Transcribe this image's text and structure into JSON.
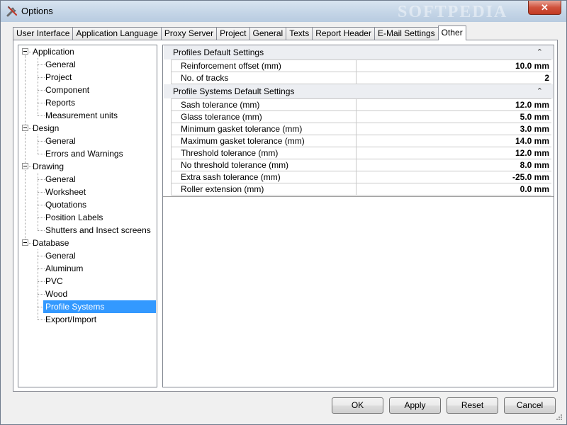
{
  "window": {
    "title": "Options",
    "close_glyph": "✕",
    "watermark": "SOFTPEDIA"
  },
  "tabs": [
    {
      "label": "User Interface",
      "active": false
    },
    {
      "label": "Application Language",
      "active": false
    },
    {
      "label": "Proxy Server",
      "active": false
    },
    {
      "label": "Project",
      "active": false
    },
    {
      "label": "General",
      "active": false
    },
    {
      "label": "Texts",
      "active": false
    },
    {
      "label": "Report Header",
      "active": false
    },
    {
      "label": "E-Mail Settings",
      "active": false
    },
    {
      "label": "Other",
      "active": true
    }
  ],
  "tree": {
    "groups": [
      {
        "label": "Application",
        "children": [
          "General",
          "Project",
          "Component",
          "Reports",
          "Measurement units"
        ]
      },
      {
        "label": "Design",
        "children": [
          "General",
          "Errors and Warnings"
        ]
      },
      {
        "label": "Drawing",
        "children": [
          "General",
          "Worksheet",
          "Quotations",
          "Position Labels",
          "Shutters and Insect screens"
        ]
      },
      {
        "label": "Database",
        "children": [
          "General",
          "Aluminum",
          "PVC",
          "Wood",
          "Profile Systems",
          "Export/Import"
        ]
      }
    ],
    "selected": "Profile Systems"
  },
  "properties": {
    "categories": [
      {
        "title": "Profiles Default Settings",
        "collapse_glyph": "⌃",
        "rows": [
          {
            "name": "Reinforcement offset (mm)",
            "value": "10.0 mm"
          },
          {
            "name": "No. of tracks",
            "value": "2"
          }
        ]
      },
      {
        "title": "Profile Systems Default Settings",
        "collapse_glyph": "⌃",
        "rows": [
          {
            "name": "Sash tolerance (mm)",
            "value": "12.0 mm"
          },
          {
            "name": "Glass tolerance (mm)",
            "value": "5.0 mm"
          },
          {
            "name": "Minimum gasket tolerance (mm)",
            "value": "3.0 mm"
          },
          {
            "name": "Maximum gasket tolerance (mm)",
            "value": "14.0 mm"
          },
          {
            "name": "Threshold tolerance (mm)",
            "value": "12.0 mm"
          },
          {
            "name": "No threshold tolerance (mm)",
            "value": "8.0 mm"
          },
          {
            "name": "Extra sash tolerance (mm)",
            "value": "-25.0 mm"
          },
          {
            "name": "Roller extension (mm)",
            "value": "0.0 mm"
          }
        ]
      }
    ]
  },
  "buttons": {
    "ok": "OK",
    "apply": "Apply",
    "reset": "Reset",
    "cancel": "Cancel"
  },
  "colors": {
    "selection": "#3399ff",
    "category_bg": "#eceef2"
  }
}
